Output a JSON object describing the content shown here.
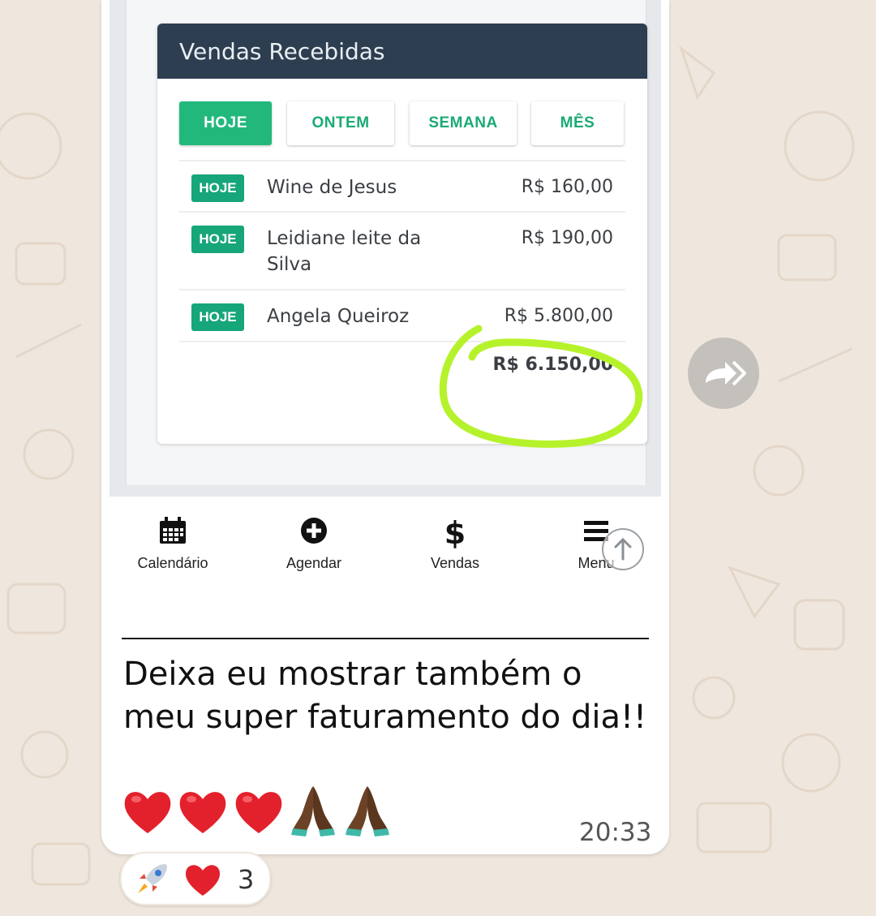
{
  "card": {
    "title": "Vendas Recebidas",
    "tabs": [
      {
        "label": "HOJE",
        "active": true
      },
      {
        "label": "ONTEM",
        "active": false
      },
      {
        "label": "SEMANA",
        "active": false
      },
      {
        "label": "MÊS",
        "active": false
      }
    ],
    "rows": [
      {
        "badge": "HOJE",
        "name": "Wine de Jesus",
        "value": "R$ 160,00"
      },
      {
        "badge": "HOJE",
        "name": "Leidiane leite da Silva",
        "value": "R$ 190,00"
      },
      {
        "badge": "HOJE",
        "name": "Angela Queiroz",
        "value": "R$ 5.800,00"
      }
    ],
    "total": "R$ 6.150,00"
  },
  "bottom_nav": {
    "items": [
      {
        "label": "Calendário",
        "icon": "calendar-icon"
      },
      {
        "label": "Agendar",
        "icon": "plus-circle-icon"
      },
      {
        "label": "Vendas",
        "icon": "dollar-icon"
      },
      {
        "label": "Menu",
        "icon": "hamburger-menu-icon"
      }
    ]
  },
  "message": {
    "text": "Deixa eu mostrar também o meu super faturamento do dia!!",
    "emojis": [
      "red-heart",
      "red-heart",
      "red-heart",
      "folded-hands",
      "folded-hands"
    ],
    "time": "20:33"
  },
  "reactions": {
    "emojis": [
      "rocket",
      "red-heart"
    ],
    "count": "3"
  },
  "colors": {
    "header_bg": "#2c3e50",
    "accent_green": "#22b87c",
    "highlight_scribble": "#b6f22b",
    "chat_bg": "#efe7dd"
  }
}
